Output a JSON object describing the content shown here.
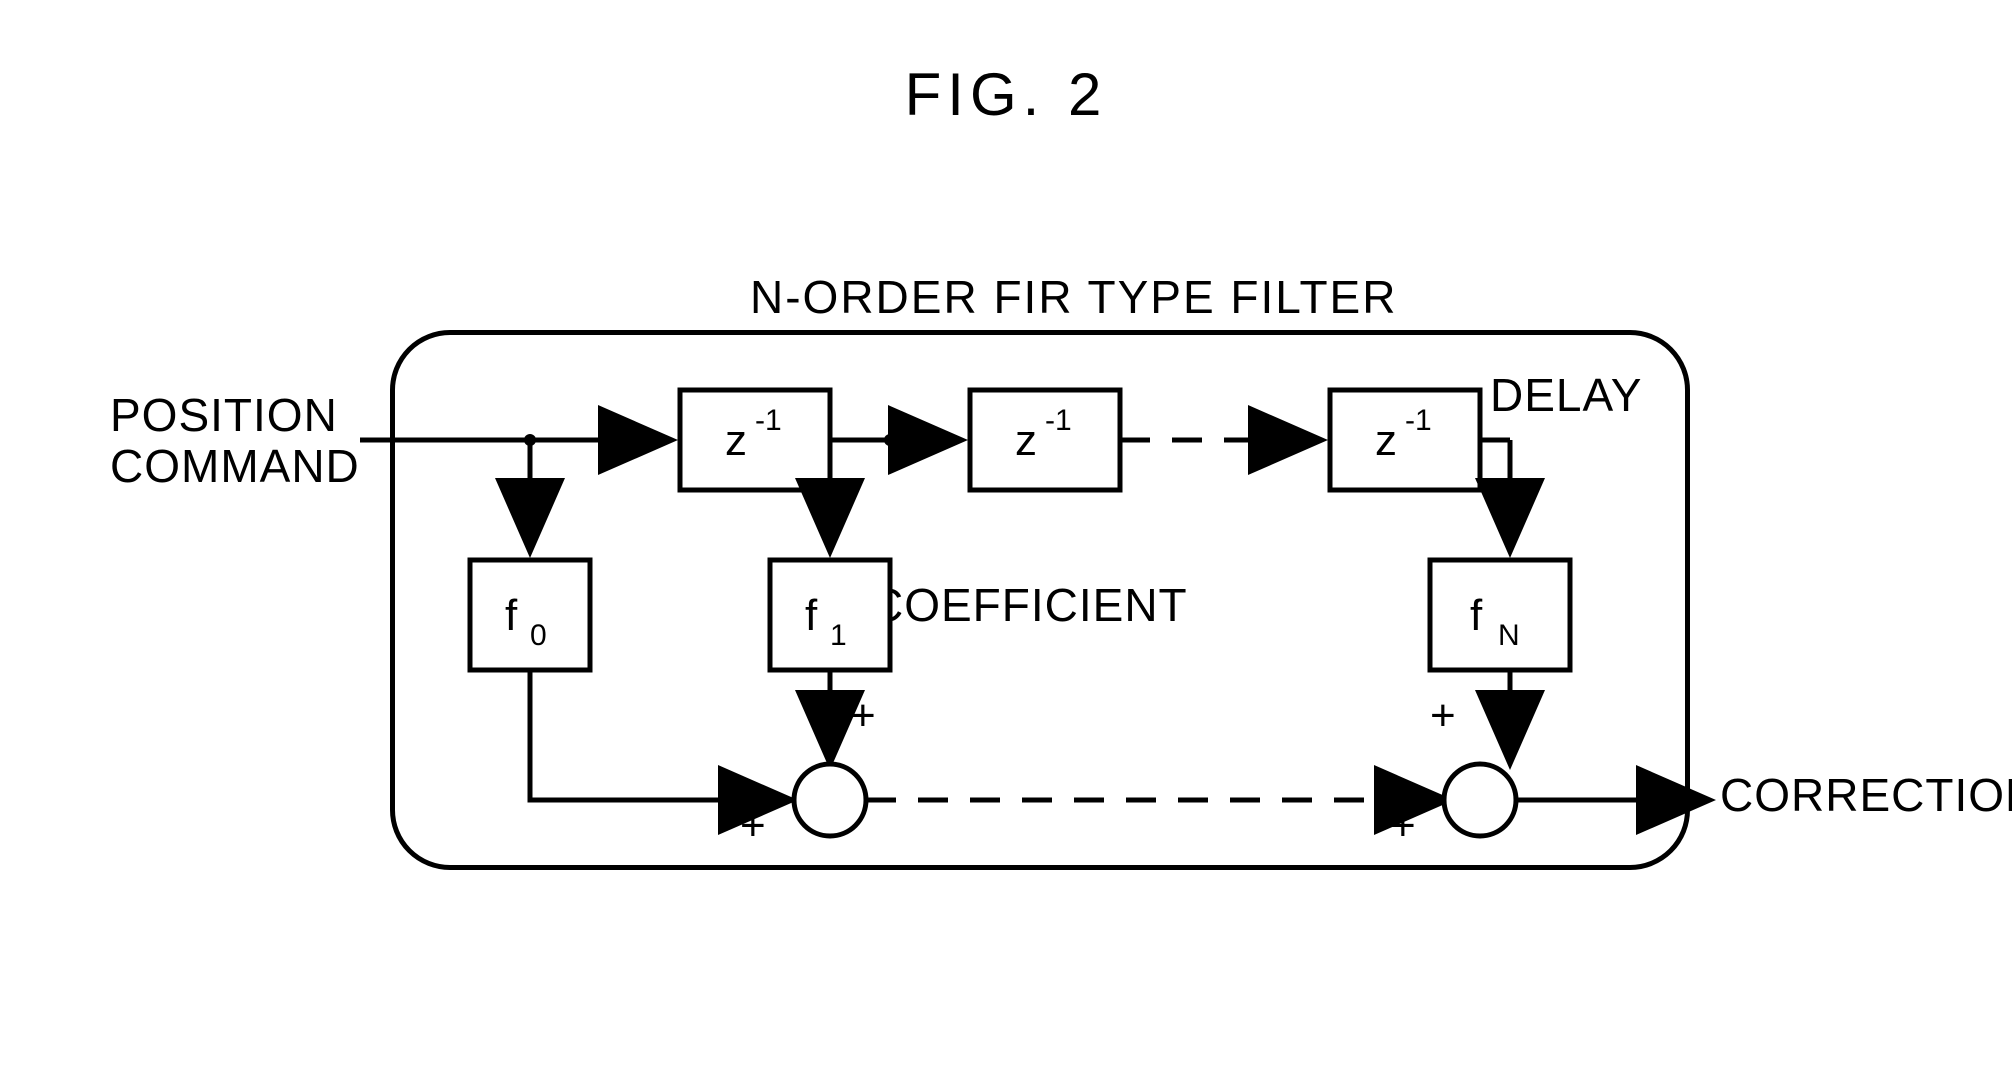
{
  "title": "FIG. 2",
  "filter_title": "N-ORDER FIR TYPE FILTER",
  "input_label": "POSITION\nCOMMAND",
  "output_label": "CORRECTION",
  "delay_label": "DELAY",
  "coefficient_label": "COEFFICIENT",
  "delay_block": {
    "base": "z",
    "exp": "-1"
  },
  "taps": {
    "f0": {
      "base": "f",
      "sub": "0"
    },
    "f1": {
      "base": "f",
      "sub": "1"
    },
    "fN": {
      "base": "f",
      "sub": "N"
    }
  },
  "signs": {
    "p1": "+",
    "p2": "+",
    "p3": "+",
    "p4": "+"
  }
}
